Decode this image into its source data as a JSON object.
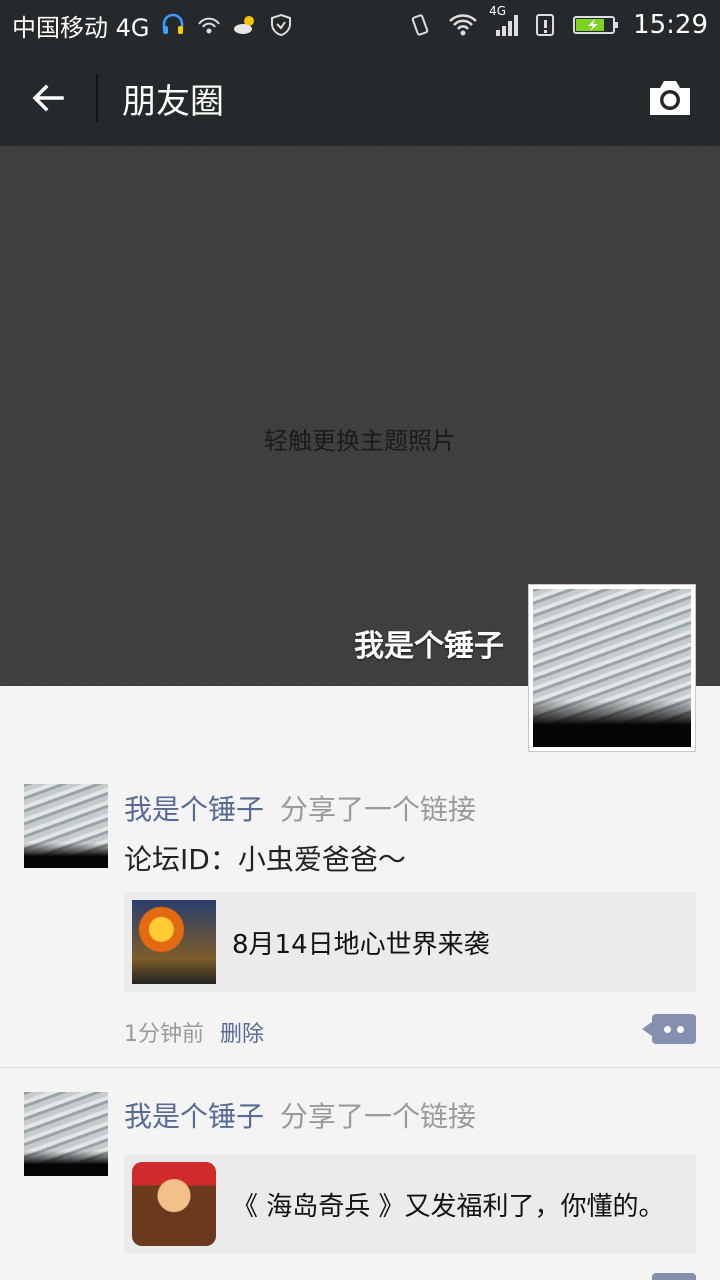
{
  "status_bar": {
    "carrier": "中国移动 4G",
    "network_label": "4G",
    "time": "15:29"
  },
  "toolbar": {
    "title": "朋友圈"
  },
  "cover": {
    "hint": "轻触更换主题照片",
    "profile_name": "我是个锤子"
  },
  "posts": [
    {
      "name": "我是个锤子",
      "action": "分享了一个链接",
      "text": "论坛ID：小虫爱爸爸～",
      "link_title": "8月14日地心世界来袭",
      "time": "1分钟前",
      "delete_label": "删除"
    },
    {
      "name": "我是个锤子",
      "action": "分享了一个链接",
      "text": "",
      "link_title": "《 海岛奇兵 》又发福利了，你懂的。",
      "time": "",
      "delete_label": ""
    }
  ],
  "icons": {
    "back": "arrow-left-icon",
    "camera": "camera-icon",
    "comment": "comment-icon"
  },
  "colors": {
    "toolbar_bg": "#24292b",
    "link_blue": "#576b95",
    "muted_text": "#9a9a9a"
  }
}
